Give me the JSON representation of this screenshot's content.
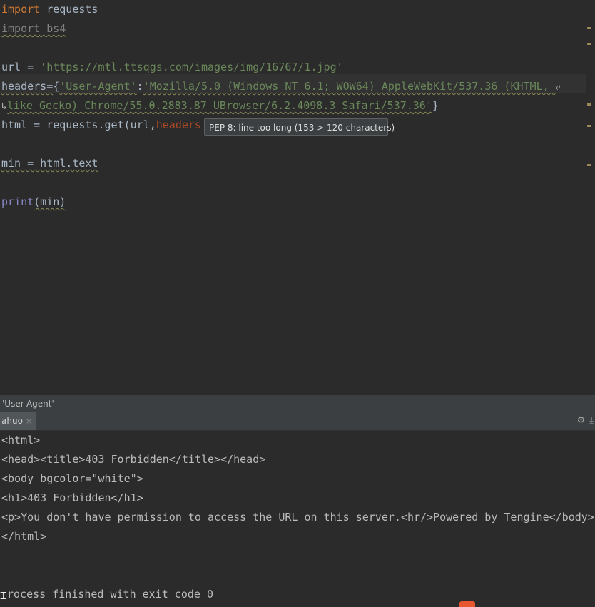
{
  "editor": {
    "lines": {
      "l1": {
        "kw": "import",
        "rest": " requests"
      },
      "l2": {
        "kw": "import",
        "rest": " bs4"
      },
      "l4": {
        "var": "url = ",
        "str": "'https://mtl.ttsqgs.com/images/img/16767/1.jpg'"
      },
      "l5": {
        "var": "headers=",
        "brace": "{",
        "key": "'User-Agent'",
        "colon": ":",
        "val": "'Mozilla/5.0 (Windows NT 6.1; WOW64) AppleWebKit/537.36 (KHTML, "
      },
      "l6": {
        "val": "like Gecko) Chrome/55.0.2883.87 UBrowser/6.2.4098.3 Safari/537.36'",
        "brace": "}"
      },
      "l7": {
        "pre": "html = requests.get(url,",
        "param": "headers"
      },
      "l9": {
        "text": "min = html.text"
      },
      "l11": {
        "fn": "print",
        "args": "(min)"
      }
    },
    "wrap_icon_right": "icon-soft-wrap",
    "wrap_icon_left": "icon-soft-wrap-continue"
  },
  "tooltip": {
    "text": "PEP 8: line too long (153 > 120 characters)"
  },
  "find_bar": {
    "text": "'User-Agent'"
  },
  "run_panel": {
    "tab_label": "ahuo",
    "tab_close": "×",
    "gear_icon": "⚙",
    "download_icon": "⤓"
  },
  "console": {
    "lines": [
      "<html>",
      "<head><title>403 Forbidden</title></head>",
      "<body bgcolor=\"white\">",
      "<h1>403 Forbidden</h1>",
      "<p>You don't have permission to access the URL on this server.<hr/>Powered by Tengine</body>",
      "</html>"
    ],
    "exit_line": "rocess finished with exit code 0"
  },
  "colors": {
    "background": "#2b2b2b",
    "keyword": "#cc7832",
    "string": "#6a8759",
    "param": "#aa4926",
    "builtin": "#8888c6"
  }
}
